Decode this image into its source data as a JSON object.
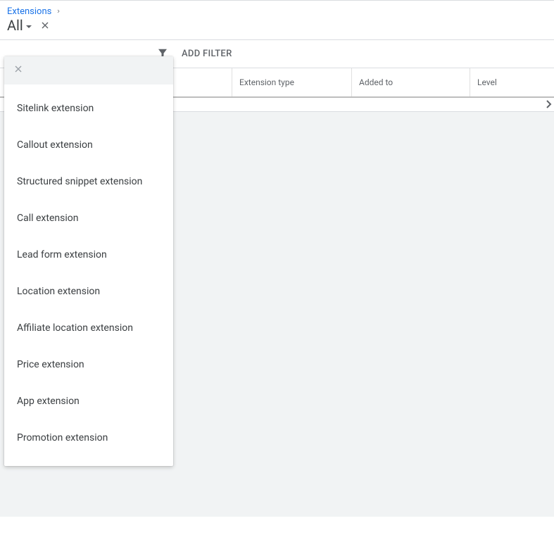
{
  "breadcrumb": {
    "label": "Extensions"
  },
  "filter": {
    "current": "All"
  },
  "toolbar": {
    "add_filter_label": "ADD FILTER"
  },
  "table": {
    "headers": {
      "ext_visible": "",
      "type": "Extension type",
      "added_to": "Added to",
      "level": "Level"
    }
  },
  "dropdown": {
    "items": [
      {
        "label": "Sitelink extension"
      },
      {
        "label": "Callout extension"
      },
      {
        "label": "Structured snippet extension"
      },
      {
        "label": "Call extension"
      },
      {
        "label": "Lead form extension"
      },
      {
        "label": "Location extension"
      },
      {
        "label": "Affiliate location extension"
      },
      {
        "label": "Price extension"
      },
      {
        "label": "App extension"
      },
      {
        "label": "Promotion extension"
      }
    ]
  }
}
